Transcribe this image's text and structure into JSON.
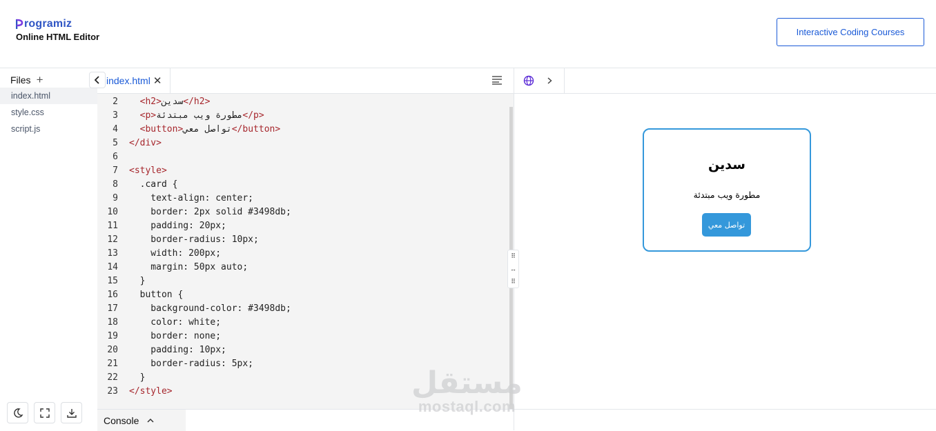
{
  "header": {
    "logo_text": "rogramiz",
    "subtitle": "Online HTML Editor",
    "cta_label": "Interactive Coding Courses"
  },
  "files": {
    "title": "Files",
    "items": [
      "index.html",
      "style.css",
      "script.js"
    ],
    "active": "index.html"
  },
  "editor": {
    "tab_label": "index.html",
    "lines": [
      {
        "n": "2",
        "t": "  <h2>سدين</h2>"
      },
      {
        "n": "3",
        "t": "  <p>مطورة ويب مبتدئة</p>"
      },
      {
        "n": "4",
        "t": "  <button>تواصل معي</button>"
      },
      {
        "n": "5",
        "t": "</div>"
      },
      {
        "n": "6",
        "t": ""
      },
      {
        "n": "7",
        "t": "<style>"
      },
      {
        "n": "8",
        "t": "  .card {"
      },
      {
        "n": "9",
        "t": "    text-align: center;"
      },
      {
        "n": "10",
        "t": "    border: 2px solid #3498db;"
      },
      {
        "n": "11",
        "t": "    padding: 20px;"
      },
      {
        "n": "12",
        "t": "    border-radius: 10px;"
      },
      {
        "n": "13",
        "t": "    width: 200px;"
      },
      {
        "n": "14",
        "t": "    margin: 50px auto;"
      },
      {
        "n": "15",
        "t": "  }"
      },
      {
        "n": "16",
        "t": "  button {"
      },
      {
        "n": "17",
        "t": "    background-color: #3498db;"
      },
      {
        "n": "18",
        "t": "    color: white;"
      },
      {
        "n": "19",
        "t": "    border: none;"
      },
      {
        "n": "20",
        "t": "    padding: 10px;"
      },
      {
        "n": "21",
        "t": "    border-radius: 5px;"
      },
      {
        "n": "22",
        "t": "  }"
      },
      {
        "n": "23",
        "t": "</style>"
      }
    ]
  },
  "console": {
    "label": "Console"
  },
  "preview": {
    "card_title": "سدين",
    "card_text": "مطورة ويب مبتدئة",
    "card_button": "تواصل معي"
  },
  "watermark": {
    "arabic": "مستقل",
    "latin": "mostaql.com"
  },
  "colors": {
    "brand_blue": "#1a5ad7",
    "card_blue": "#3498db",
    "tag_red": "#a6262c",
    "editor_bg": "#f4f4f4"
  }
}
